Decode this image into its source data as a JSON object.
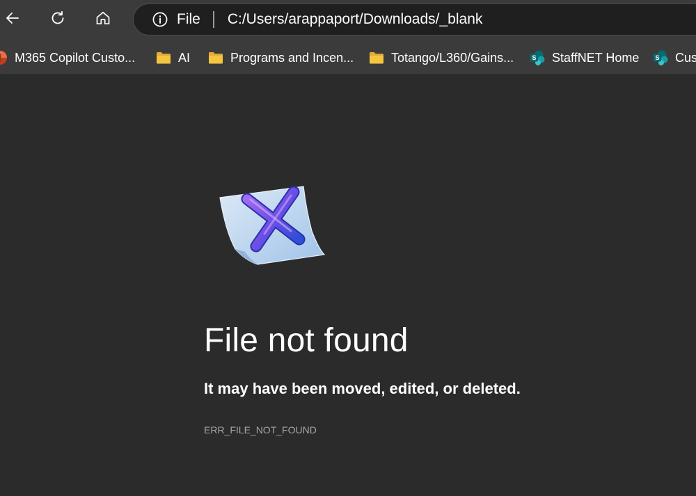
{
  "toolbar": {
    "back_icon": "back-arrow-icon",
    "reload_icon": "reload-icon",
    "home_icon": "home-icon"
  },
  "address_bar": {
    "info_icon": "info-icon",
    "site_label": "File",
    "url": "C:/Users/arappaport/Downloads/_blank"
  },
  "bookmarks": {
    "items": [
      {
        "label": "M365 Copilot Custo...",
        "icon": "powerpoint-icon"
      },
      {
        "label": "AI",
        "icon": "folder-icon"
      },
      {
        "label": "Programs and Incen...",
        "icon": "folder-icon"
      },
      {
        "label": "Totango/L360/Gains...",
        "icon": "folder-icon"
      },
      {
        "label": "StaffNET Home",
        "icon": "sharepoint-icon"
      },
      {
        "label": "Cus",
        "icon": "sharepoint-icon"
      }
    ]
  },
  "error": {
    "illustration": "file-error-icon",
    "title": "File not found",
    "subtitle": "It may have been moved, edited, or deleted.",
    "code": "ERR_FILE_NOT_FOUND"
  },
  "colors": {
    "page_background": "#2b2b2b",
    "toolbar_background": "#3b3b3b",
    "address_bar_background": "#1f1f1f",
    "folder_yellow": "#f5c542",
    "sharepoint_teal": "#0f7b83",
    "error_code_gray": "#a6a6a6"
  }
}
